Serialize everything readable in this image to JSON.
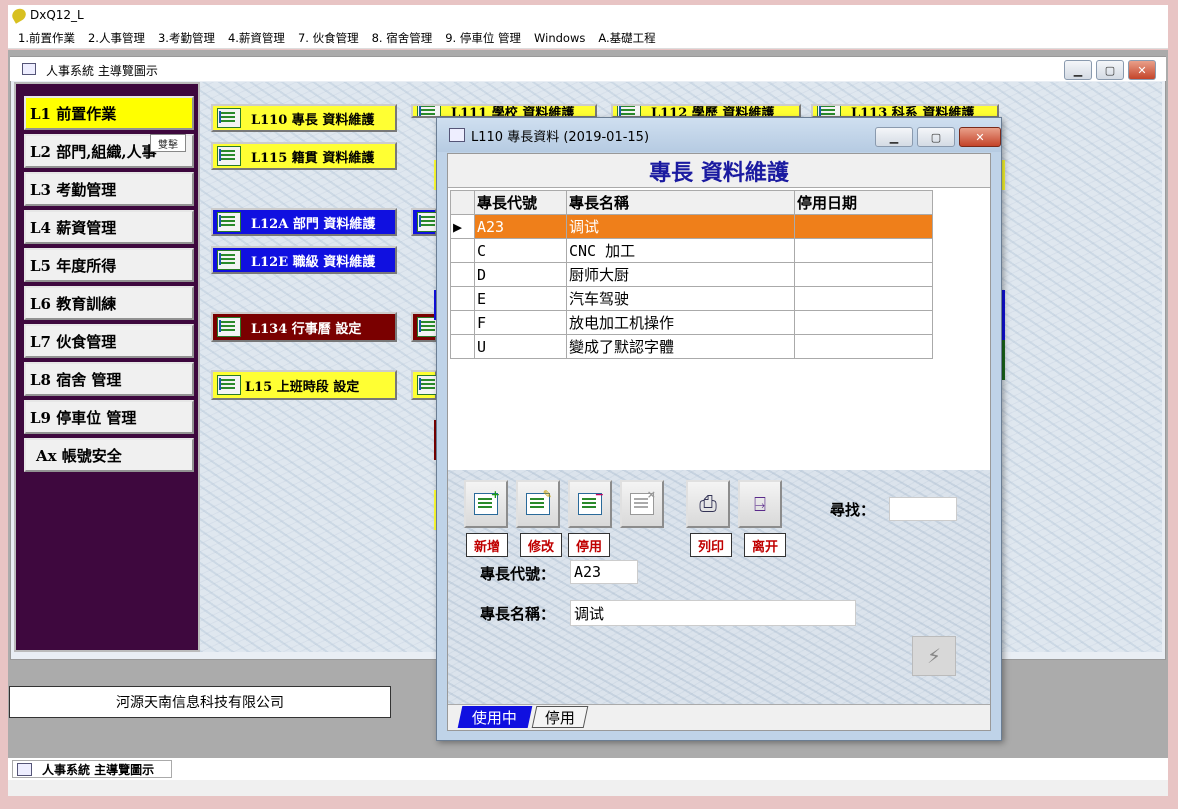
{
  "app": {
    "title": "DxQ12_L"
  },
  "menu": [
    "1.前置作業",
    "2.人事管理",
    "3.考勤管理",
    "4.薪資管理",
    "7. 伙食管理",
    "8. 宿舍管理",
    "9. 停車位 管理",
    "Windows",
    "A.基礎工程"
  ],
  "main_window": {
    "title": "人事系統 主導覽圖示"
  },
  "nav": [
    "L1  前置作業",
    "L2  部門,組織,人事",
    "L3  考勤管理",
    "L4  薪資管理",
    "L5  年度所得",
    "L6  教育訓練",
    "L7  伙食管理",
    "L8  宿舍 管理",
    "L9  停車位 管理",
    "Ax  帳號安全"
  ],
  "tooltip": "雙擊",
  "tiles": {
    "l110": "L110  專長  資料維護",
    "l111": "L111  學校  資料維護",
    "l112": "L112  學歷  資料維護",
    "l113": "L113  科系  資料維護",
    "l115": "L115  籍貫  資料維護",
    "l12a": "L12A  部門  資料維護",
    "l12e": "L12E  職級  資料維護",
    "l134": "L134  行事曆  設定",
    "l15": "L15  上班時段  設定"
  },
  "company": "河源天南信息科技有限公司",
  "taskbar": {
    "item": "人事系統 主導覽圖示"
  },
  "dialog": {
    "title": "L110 專長資料 (2019-01-15)",
    "header": "專長 資料維護",
    "columns": [
      "專長代號",
      "專長名稱",
      "停用日期"
    ],
    "rows": [
      {
        "code": "A23",
        "name": "调试",
        "date": ""
      },
      {
        "code": "C",
        "name": "CNC 加工",
        "date": ""
      },
      {
        "code": "D",
        "name": "厨师大厨",
        "date": ""
      },
      {
        "code": "E",
        "name": "汽车驾驶",
        "date": ""
      },
      {
        "code": "F",
        "name": "放电加工机操作",
        "date": ""
      },
      {
        "code": "U",
        "name": "變成了默認字體",
        "date": ""
      }
    ],
    "buttons": {
      "add": "新增",
      "edit": "修改",
      "disable": "停用",
      "print": "列印",
      "exit": "离开"
    },
    "search_label": "尋找：",
    "search_value": "",
    "code_label": "專長代號：",
    "code_value": "A23",
    "name_label": "專長名稱：",
    "name_value": "调试",
    "tabs": [
      "使用中",
      "停用"
    ]
  },
  "colors": {
    "accent_yellow": "#ffff33",
    "accent_blue": "#1010e0",
    "accent_red": "#7a0000",
    "nav_bg": "#3e083e",
    "selected_row": "#ef7f1a"
  }
}
